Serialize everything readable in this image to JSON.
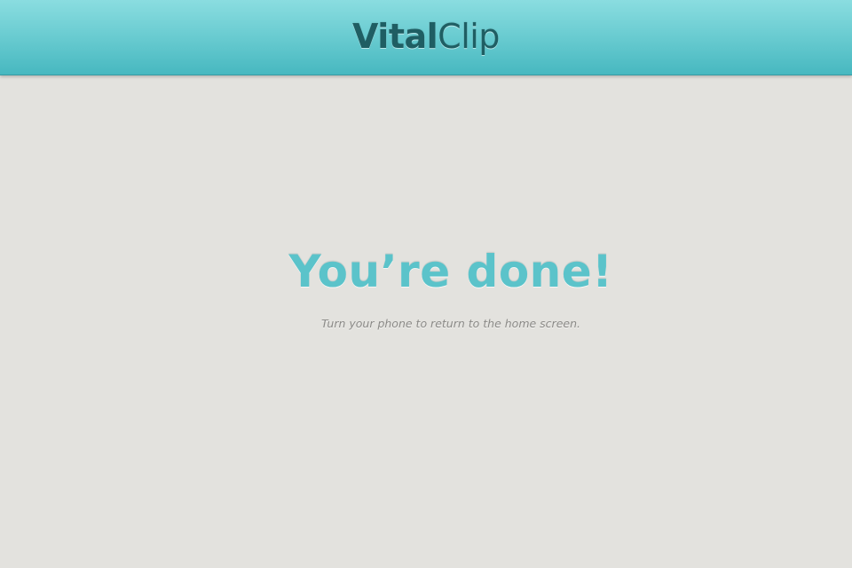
{
  "header": {
    "logo_bold": "Vital",
    "logo_light": "Clip"
  },
  "main": {
    "title": "You’re done!",
    "subtitle": "Turn your phone to return to the home screen."
  },
  "colors": {
    "header_top": "#8adde0",
    "header_bottom": "#47b8c0",
    "logo_text": "#1f5e63",
    "background": "#e3e2de",
    "title_text": "#5bc3ca",
    "subtitle_text": "#8a8986"
  }
}
